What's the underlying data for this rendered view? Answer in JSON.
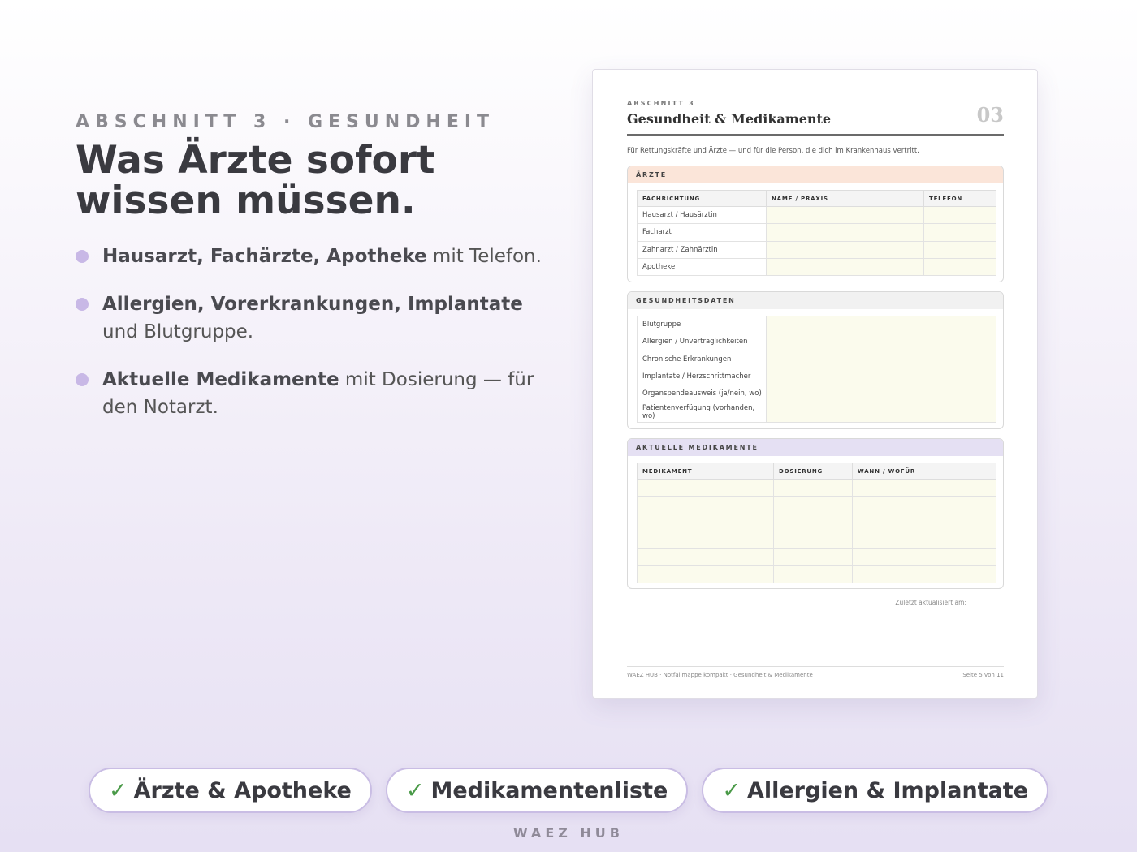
{
  "left": {
    "eyebrow": "ABSCHNITT 3 · GESUNDHEIT",
    "headline_line1": "Was Ärzte sofort",
    "headline_line2": "wissen müssen.",
    "bullets": [
      {
        "bold": "Hausarzt, Fachärzte, Apotheke",
        "rest": " mit Telefon."
      },
      {
        "bold": "Allergien, Vorerkrankungen, Implantate",
        "rest": " und Blutgruppe."
      },
      {
        "bold": "Aktuelle Medikamente",
        "rest": " mit Dosierung — für den Notarzt."
      }
    ]
  },
  "document": {
    "eyebrow": "ABSCHNITT 3",
    "title": "Gesundheit & Medikamente",
    "page_number": "03",
    "intro": "Für Rettungskräfte und Ärzte — und für die Person, die dich im Krankenhaus vertritt.",
    "aerzte": {
      "heading": "ÄRZTE",
      "columns": [
        "FACHRICHTUNG",
        "NAME / PRAXIS",
        "TELEFON"
      ],
      "rows": [
        "Hausarzt / Hausärztin",
        "Facharzt",
        "Zahnarzt / Zahnärztin",
        "Apotheke"
      ]
    },
    "gesundheit": {
      "heading": "GESUNDHEITSDATEN",
      "rows": [
        "Blutgruppe",
        "Allergien / Unverträglichkeiten",
        "Chronische Erkrankungen",
        "Implantate / Herzschrittmacher",
        "Organspendeausweis (ja/nein, wo)",
        "Patientenverfügung (vorhanden, wo)"
      ]
    },
    "medikamente": {
      "heading": "AKTUELLE MEDIKAMENTE",
      "columns": [
        "MEDIKAMENT",
        "DOSIERUNG",
        "WANN / WOFÜR"
      ],
      "empty_rows": 6
    },
    "updated_label": "Zuletzt aktualisiert am:",
    "footer_left": "WAEZ HUB · Notfallmappe kompakt · Gesundheit & Medikamente",
    "footer_right": "Seite 5 von 11"
  },
  "pills": [
    {
      "check": "✓",
      "label": "Ärzte & Apotheke"
    },
    {
      "check": "✓",
      "label": "Medikamentenliste"
    },
    {
      "check": "✓",
      "label": "Allergien & Implantate"
    }
  ],
  "brand": "WAEZ HUB",
  "colors": {
    "accent_dot": "#c8b8e6",
    "check": "#4a9a48",
    "pill_border": "#c9bde4",
    "fill_cell": "#fbfbed"
  }
}
